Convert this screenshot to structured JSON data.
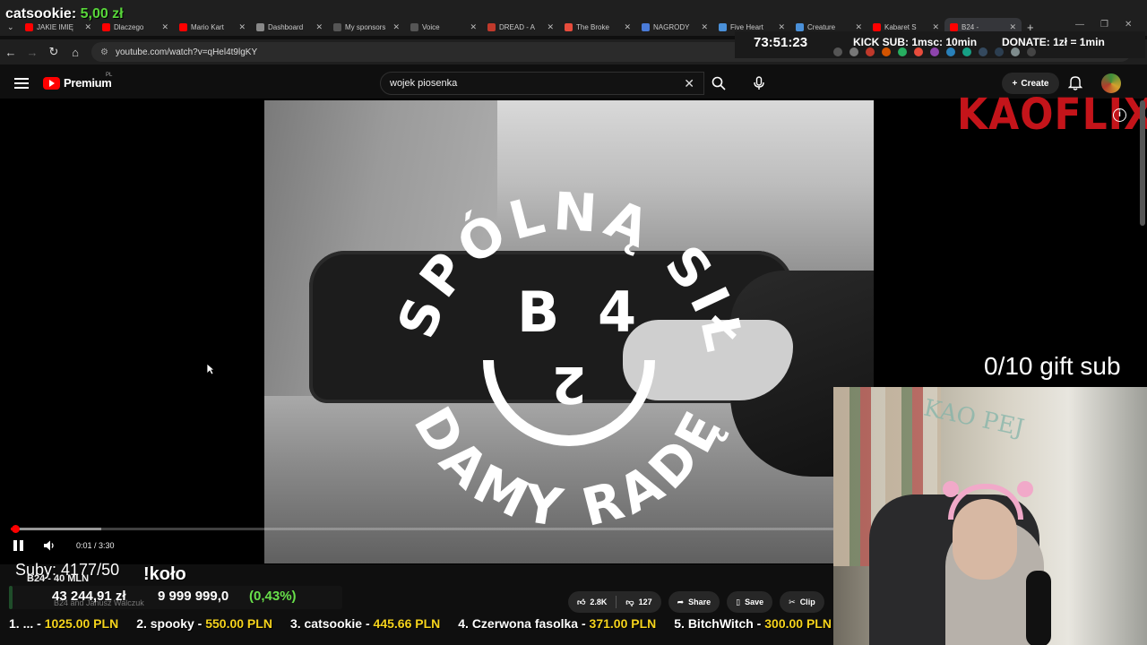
{
  "browser": {
    "tabs": [
      {
        "title": "JAKIE IMIĘ",
        "color": "#ff0000"
      },
      {
        "title": "Dlaczego",
        "color": "#ff0000"
      },
      {
        "title": "Mario Kart",
        "color": "#ff0000"
      },
      {
        "title": "Dashboard",
        "color": "#888888"
      },
      {
        "title": "My sponsors",
        "color": "#555555"
      },
      {
        "title": "Voice",
        "color": "#555555"
      },
      {
        "title": "DREAD - A",
        "color": "#c0392b"
      },
      {
        "title": "The Broke",
        "color": "#e74c3c"
      },
      {
        "title": "NAGRODY",
        "color": "#4a7bd8"
      },
      {
        "title": "Five Heart",
        "color": "#4a90d9"
      },
      {
        "title": "Creature",
        "color": "#4a90d9"
      },
      {
        "title": "Kabaret S",
        "color": "#ff0000"
      },
      {
        "title": "B24 -",
        "color": "#ff0000"
      }
    ],
    "url": "youtube.com/watch?v=qHel4t9lgKY"
  },
  "youtube": {
    "logo_text": "Premium",
    "country": "PL",
    "search_value": "wojek piosenka",
    "create_label": "Create"
  },
  "video": {
    "emblem_top": "WSPÓLNĄ SIŁĄ",
    "emblem_bottom": "DAMY RADĘ",
    "emblem_letters": [
      "B",
      "4",
      "2"
    ],
    "timecode": "0:01 / 3:30",
    "progress_played": 0.005,
    "progress_buffered": 0.11
  },
  "overlay": {
    "donor_name": "catsookie:",
    "donor_amount": "5,00 zł",
    "timer": "73:51:23",
    "kick_rule": "KICK SUB: 1msc: 10min",
    "donate_rule": "DONATE: 1zł = 1min",
    "brand": "KAOFLIX",
    "gift_sub": "0/10 gift sub",
    "subs": "Suby: 4177/50",
    "kolo": "!koło",
    "webcam_text": "KAO PEJ",
    "goal": {
      "name": "B24 - 40 MLN",
      "raised": "43 244,91 zł",
      "target": "9 999 999,0",
      "percent": "(0,43%)",
      "fill_fraction": 0.0043
    },
    "channel_line": "B24 and Janusz Walczuk"
  },
  "actions": {
    "likes": "2.8K",
    "dislikes": "127",
    "share": "Share",
    "save": "Save",
    "clip": "Clip"
  },
  "leaderboard": [
    {
      "name": "1. ... -",
      "value": "1025.00 PLN"
    },
    {
      "name": "2. spooky -",
      "value": "550.00 PLN"
    },
    {
      "name": "3. catsookie -",
      "value": "445.66 PLN"
    },
    {
      "name": "4. Czerwona fasolka -",
      "value": "371.00 PLN"
    },
    {
      "name": "5. BitchWitch -",
      "value": "300.00 PLN"
    }
  ],
  "colors": {
    "yt_red": "#ff0000",
    "kaoflix_red": "#c4141a",
    "goal_green": "#68e04a",
    "ticker_gold": "#f5d31c"
  }
}
